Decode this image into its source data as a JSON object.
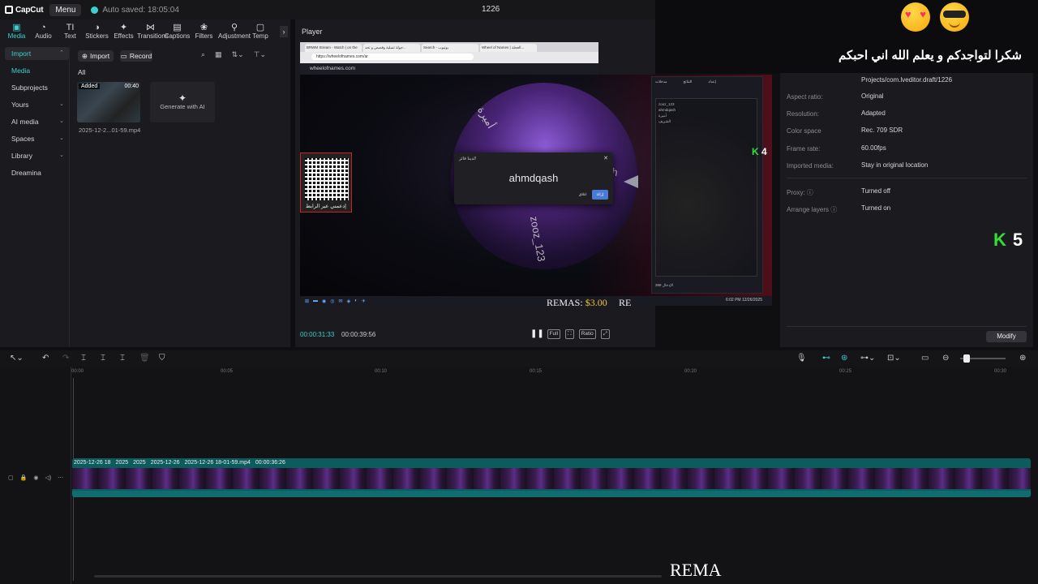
{
  "app": {
    "logo_text": "CapCut",
    "menu_label": "Menu",
    "autosave_text": "Auto saved: 18:05:04",
    "project_title": "1226"
  },
  "overlay": {
    "caption": "شكرا لتواجدكم و يعلم الله اني احبكم",
    "emoji_left": "heart-eyes-emoji",
    "emoji_right": "sunglasses-emoji",
    "k4_label": "K",
    "k4_value": "4",
    "k5_label": "K",
    "k5_value": "5",
    "remas_bottom": "REMA"
  },
  "toolbar": {
    "items": [
      {
        "label": "Media",
        "icon": "▣"
      },
      {
        "label": "Audio",
        "icon": "◔"
      },
      {
        "label": "Text",
        "icon": "TI"
      },
      {
        "label": "Stickers",
        "icon": "◑"
      },
      {
        "label": "Effects",
        "icon": "✦"
      },
      {
        "label": "Transitions",
        "icon": "⋈"
      },
      {
        "label": "Captions",
        "icon": "▤"
      },
      {
        "label": "Filters",
        "icon": "❀"
      },
      {
        "label": "Adjustment",
        "icon": "⚲"
      },
      {
        "label": "Temp",
        "icon": "▢"
      }
    ],
    "next_icon": "›"
  },
  "sidebar": {
    "items": [
      {
        "label": "Import",
        "chev": "⌃"
      },
      {
        "label": "Media",
        "chev": ""
      },
      {
        "label": "Subprojects",
        "chev": ""
      },
      {
        "label": "Yours",
        "chev": "⌄"
      },
      {
        "label": "AI media",
        "chev": "⌄"
      },
      {
        "label": "Spaces",
        "chev": "⌄"
      },
      {
        "label": "Library",
        "chev": "⌄"
      },
      {
        "label": "Dreamina",
        "chev": ""
      }
    ]
  },
  "media": {
    "import_label": "Import",
    "record_label": "Record",
    "filter_label": "All",
    "clip_added": "Added",
    "clip_duration": "00:40",
    "clip_name": "2025-12-2...01-59.mp4",
    "generate_label": "Generate with AI"
  },
  "player": {
    "title": "Player",
    "browser_tabs": [
      "BRWM Stream - Watch | on the ...",
      "جولة تسلية وقصص و تحد...",
      "Search - يوتيوب",
      "Wheel of Names | العجلة..."
    ],
    "browser_url": "https://wheelofnames.com/ar",
    "site_name": "wheelofnames.com",
    "wheel_text_1": "zooz_123",
    "wheel_text_2": "أميرة",
    "wheel_text_3": "sh",
    "winner_heading": "لدينا فائز!",
    "winner_name": "ahmdqash",
    "winner_btn_1": "اغلاق",
    "winner_btn_2": "إزالة",
    "qr_label": "إدعمني عبر الرابط",
    "names_tabs": [
      "مدخلات",
      "النتائج",
      "إعداد"
    ],
    "names_list": [
      "zooz_123",
      "ahmdqash",
      "أميرة",
      "الشريف"
    ],
    "names_footer": "الإدخال 388",
    "remas_label": "REMAS:",
    "remas_amount": "$3.00",
    "remas_tail": "RE",
    "taskbar_time": "6:02 PM",
    "taskbar_date": "12/26/2025",
    "time_current": "00:00:31:33",
    "time_total": "00:00:39:56",
    "play_icon": "❚❚",
    "tools": [
      "Full",
      "⛶",
      "Ratio",
      "⤢"
    ]
  },
  "details": {
    "path": "Projects/com.lveditor.draft/1226",
    "rows": [
      {
        "label": "Aspect ratio:",
        "value": "Original"
      },
      {
        "label": "Resolution:",
        "value": "Adapted"
      },
      {
        "label": "Color space",
        "value": "Rec. 709 SDR"
      },
      {
        "label": "Frame rate:",
        "value": "60.00fps"
      },
      {
        "label": "Imported media:",
        "value": "Stay in original location"
      },
      {
        "label": "Proxy:",
        "value": "Turned off"
      },
      {
        "label": "Arrange layers",
        "value": "Turned on"
      }
    ],
    "modify_label": "Modify"
  },
  "timeline": {
    "ticks": [
      "00:00",
      "00:05",
      "00:10",
      "00:15",
      "00:20",
      "00:25",
      "00:30"
    ],
    "clip_labels": [
      "2025-12-26 18",
      "2025",
      "2025",
      "2025-12-26",
      "2025-12-26 18-01-59.mp4",
      "00:00:36:26"
    ]
  }
}
